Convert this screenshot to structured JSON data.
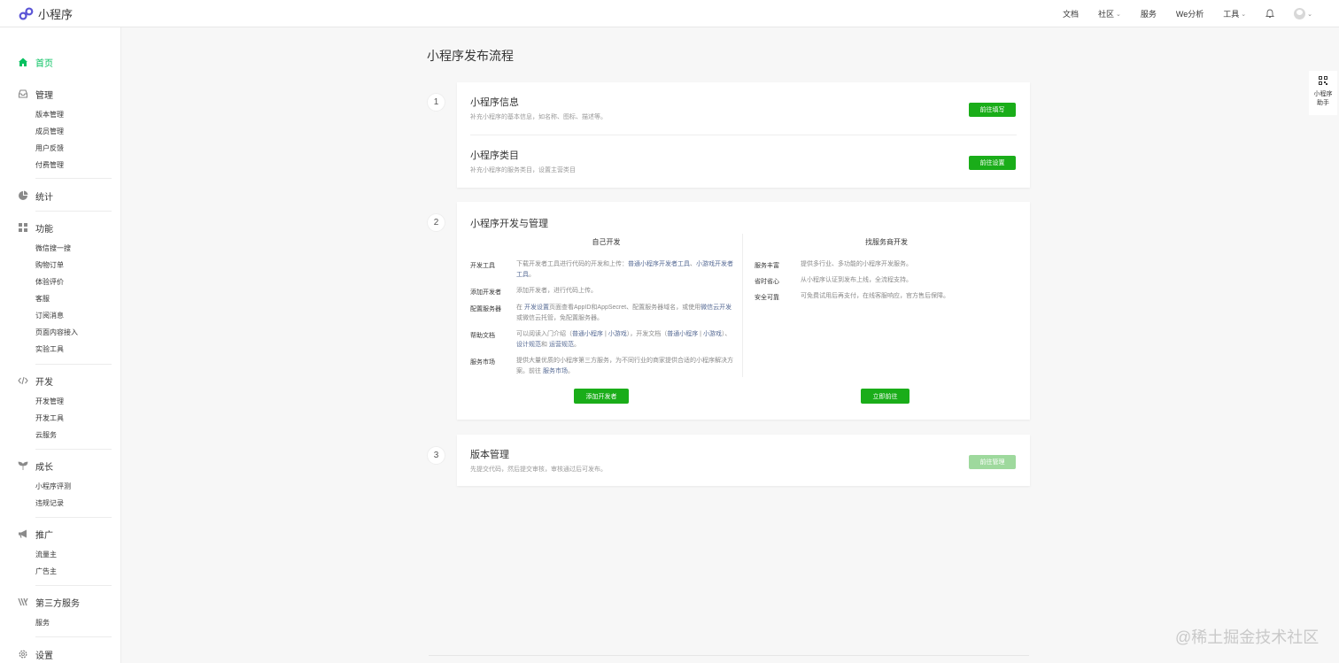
{
  "app": {
    "logo_text": "小程序"
  },
  "topnav": {
    "docs": "文档",
    "community": "社区",
    "service": "服务",
    "we_analytics": "We分析",
    "tools": "工具"
  },
  "sidebar": {
    "home": "首页",
    "manage": {
      "label": "管理",
      "items": [
        "版本管理",
        "成员管理",
        "用户反馈",
        "付费管理"
      ]
    },
    "stats": "统计",
    "features": {
      "label": "功能",
      "items": [
        "微信搜一搜",
        "购物订单",
        "体验评价",
        "客服",
        "订阅消息",
        "页面内容接入",
        "实验工具"
      ]
    },
    "dev": {
      "label": "开发",
      "items": [
        "开发管理",
        "开发工具",
        "云服务"
      ]
    },
    "growth": {
      "label": "成长",
      "items": [
        "小程序评测",
        "违规记录"
      ]
    },
    "promote": {
      "label": "推广",
      "items": [
        "流量主",
        "广告主"
      ]
    },
    "third_party": {
      "label": "第三方服务",
      "items": [
        "服务"
      ]
    },
    "settings": "设置"
  },
  "main": {
    "title": "小程序发布流程",
    "step1": {
      "number": "1",
      "info_title": "小程序信息",
      "info_desc": "补充小程序的基本信息，如名称、图标、描述等。",
      "info_button": "前往填写",
      "category_title": "小程序类目",
      "category_desc": "补充小程序的服务类目，设置主营类目",
      "category_button": "前往设置"
    },
    "step2": {
      "number": "2",
      "title": "小程序开发与管理",
      "self_dev": {
        "heading": "自己开发",
        "rows": [
          {
            "label": "开发工具",
            "pre": "下载开发者工具进行代码的开发和上传：",
            "link1": "普通小程序开发者工具",
            "mid": "、",
            "link2": "小游戏开发者工具",
            "post": "。"
          },
          {
            "label": "添加开发者",
            "text": "添加开发者，进行代码上传。"
          },
          {
            "label": "配置服务器",
            "pre": "在 ",
            "link1": "开发设置",
            "mid": "页面查看AppID和AppSecret、配置服务器域名，或使用",
            "link2": "微信云开发",
            "post": "或微信云托管，免配置服务器。"
          },
          {
            "label": "帮助文档",
            "pre": "可以阅读入门介绍（",
            "link1": "普通小程序",
            "sep1": " | ",
            "link2": "小游戏",
            "mid": "），开发文档（",
            "link3": "普通小程序",
            "sep2": " | ",
            "link4": "小游戏",
            "mid2": "）、",
            "link5": "设计规范",
            "and": "和 ",
            "link6": "运营规范",
            "post": "。"
          },
          {
            "label": "服务市场",
            "pre": "提供大量优质的小程序第三方服务，为不同行业的商家提供合适的小程序解决方案。前往 ",
            "link1": "服务市场",
            "post": "。"
          }
        ],
        "button": "添加开发者"
      },
      "vendor_dev": {
        "heading": "找服务商开发",
        "rows": [
          {
            "label": "服务丰富",
            "text": "提供多行业、多功能的小程序开发服务。"
          },
          {
            "label": "省时省心",
            "text": "从小程序认证到发布上线，全流程支持。"
          },
          {
            "label": "安全可靠",
            "text": "可免费试用后再支付，在线客服响应，官方售后保障。"
          }
        ],
        "button": "立即前往"
      }
    },
    "step3": {
      "number": "3",
      "title": "版本管理",
      "desc": "先提交代码，然后提交审核，审核通过后可发布。",
      "button": "前往管理"
    }
  },
  "assistant": {
    "label_line1": "小程序",
    "label_line2": "助手"
  },
  "watermark": "@稀土掘金技术社区",
  "colors": {
    "brand_green": "#1aad19",
    "active_green": "#07c160",
    "link_blue": "#576b95"
  }
}
